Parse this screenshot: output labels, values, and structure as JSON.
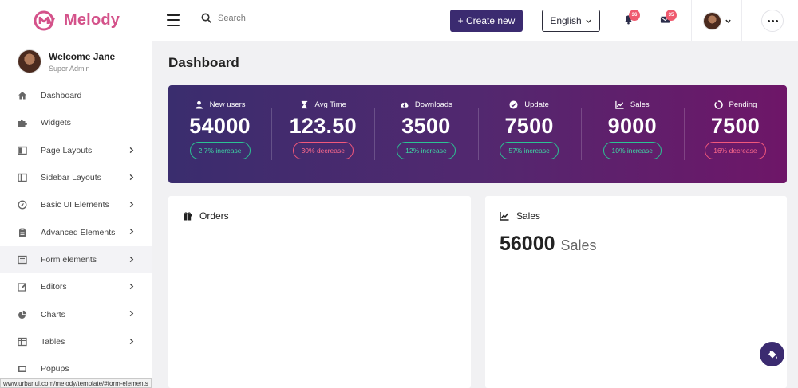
{
  "brand": {
    "name": "Melody"
  },
  "topbar": {
    "search_placeholder": "Search",
    "create_label": "+ Create new",
    "language": "English",
    "notifications_count": "36",
    "messages_count": "35"
  },
  "user": {
    "welcome": "Welcome Jane",
    "role": "Super Admin"
  },
  "sidebar": {
    "items": [
      {
        "label": "Dashboard",
        "icon": "home-icon"
      },
      {
        "label": "Widgets",
        "icon": "puzzle-icon"
      },
      {
        "label": "Page Layouts",
        "icon": "layout-icon"
      },
      {
        "label": "Sidebar Layouts",
        "icon": "sidebar-icon"
      },
      {
        "label": "Basic UI Elements",
        "icon": "compass-icon"
      },
      {
        "label": "Advanced Elements",
        "icon": "clipboard-icon"
      },
      {
        "label": "Form elements",
        "icon": "form-icon"
      },
      {
        "label": "Editors",
        "icon": "edit-icon"
      },
      {
        "label": "Charts",
        "icon": "pie-chart-icon"
      },
      {
        "label": "Tables",
        "icon": "table-icon"
      },
      {
        "label": "Popups",
        "icon": "popup-icon"
      }
    ]
  },
  "main": {
    "title": "Dashboard",
    "stats": [
      {
        "label": "New users",
        "value": "54000",
        "change": "2.7% increase",
        "icon": "user-icon"
      },
      {
        "label": "Avg Time",
        "value": "123.50",
        "change": "30% decrease",
        "icon": "hourglass-icon"
      },
      {
        "label": "Downloads",
        "value": "3500",
        "change": "12% increase",
        "icon": "cloud-download-icon"
      },
      {
        "label": "Update",
        "value": "7500",
        "change": "57% increase",
        "icon": "check-circle-icon"
      },
      {
        "label": "Sales",
        "value": "9000",
        "change": "10% increase",
        "icon": "line-chart-icon"
      },
      {
        "label": "Pending",
        "value": "7500",
        "change": "16% decrease",
        "icon": "circle-notch-icon"
      }
    ],
    "orders": {
      "title": "Orders"
    },
    "sales": {
      "title": "Sales",
      "value": "56000",
      "unit": "Sales"
    }
  },
  "colors": {
    "primary": "#3b2b70",
    "brand_pink": "#d4528a",
    "increase": "#3dd9a4",
    "decrease": "#ff6b8c",
    "badge": "#ef5a6f"
  },
  "status_bar": {
    "url": "www.urbanui.com/melody/template/#form-elements"
  }
}
